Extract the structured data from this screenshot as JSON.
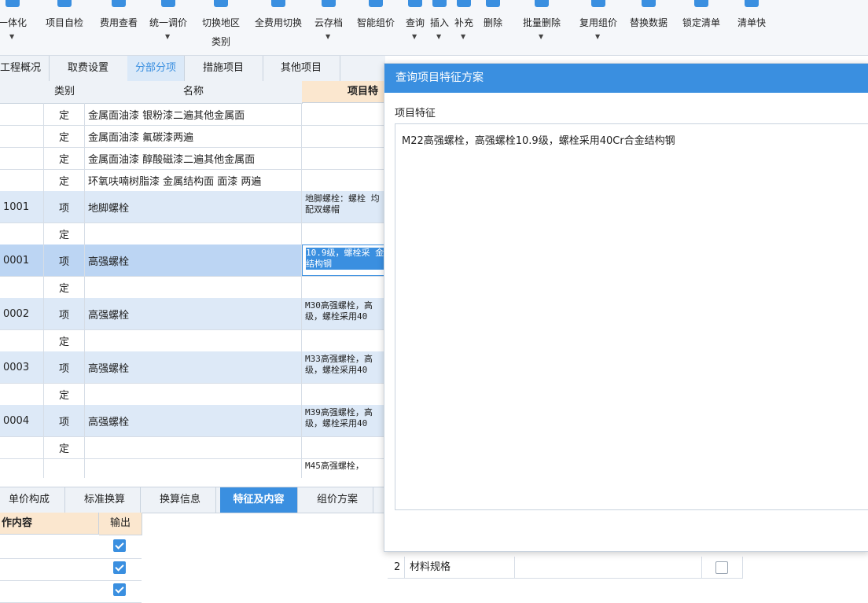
{
  "toolbar": {
    "buttons": [
      {
        "label": "一体化",
        "caret": true
      },
      {
        "label": "项目自检",
        "caret": false
      },
      {
        "label": "费用查看",
        "caret": false
      },
      {
        "label": "统一调价",
        "caret": true
      },
      {
        "label": "切换地区",
        "label2": "类别",
        "caret": false
      },
      {
        "label": "全费用切换",
        "caret": false
      },
      {
        "label": "云存档",
        "caret": true
      },
      {
        "label": "智能组价",
        "caret": false
      },
      {
        "label": "查询",
        "caret": true
      },
      {
        "label": "插入",
        "caret": true
      },
      {
        "label": "补充",
        "caret": true
      },
      {
        "label": "删除",
        "caret": false
      },
      {
        "label": "批量删除",
        "caret": true
      },
      {
        "label": "复用组价",
        "caret": true
      },
      {
        "label": "替换数据",
        "caret": false
      },
      {
        "label": "锁定清单",
        "caret": false
      },
      {
        "label": "清单快",
        "caret": false
      }
    ]
  },
  "tabs": [
    {
      "label": "工程概况"
    },
    {
      "label": "取费设置"
    },
    {
      "label": "分部分项"
    },
    {
      "label": "措施项目"
    },
    {
      "label": "其他项目"
    }
  ],
  "grid": {
    "headers": {
      "type": "类别",
      "name": "名称",
      "feature": "项目特"
    },
    "rows": [
      {
        "code": "",
        "type": "定",
        "name": "金属面油漆 银粉漆二遍其他金属面",
        "feature": ""
      },
      {
        "code": "",
        "type": "定",
        "name": "金属面油漆 氟碳漆两遍",
        "feature": ""
      },
      {
        "code": "",
        "type": "定",
        "name": "金属面油漆 醇酸磁漆二遍其他金属面",
        "feature": ""
      },
      {
        "code": "",
        "type": "定",
        "name": "环氧呋喃树脂漆 金属结构面 面漆 两遍",
        "feature": ""
      },
      {
        "code": "1001",
        "type": "项",
        "name": "地脚螺栓",
        "feature": "地脚螺栓：螺栓 均配双螺帽"
      },
      {
        "code": "",
        "type": "定",
        "name": "",
        "feature": ""
      },
      {
        "code": "0001",
        "type": "项",
        "name": "高强螺栓",
        "feature": "10.9级，螺栓采 金结构钢"
      },
      {
        "code": "",
        "type": "定",
        "name": "",
        "feature": ""
      },
      {
        "code": "0002",
        "type": "项",
        "name": "高强螺栓",
        "feature": "M30高强螺栓，高 级，螺栓采用40"
      },
      {
        "code": "",
        "type": "定",
        "name": "",
        "feature": ""
      },
      {
        "code": "0003",
        "type": "项",
        "name": "高强螺栓",
        "feature": "M33高强螺栓，高 级，螺栓采用40"
      },
      {
        "code": "",
        "type": "定",
        "name": "",
        "feature": ""
      },
      {
        "code": "0004",
        "type": "项",
        "name": "高强螺栓",
        "feature": "M39高强螺栓，高 级，螺栓采用40"
      },
      {
        "code": "",
        "type": "定",
        "name": "",
        "feature": ""
      },
      {
        "code": "",
        "type": "",
        "name": "",
        "feature": "M45高强螺栓，"
      }
    ]
  },
  "bottom_tabs": [
    {
      "label": "单价构成"
    },
    {
      "label": "标准换算"
    },
    {
      "label": "换算信息"
    },
    {
      "label": "特征及内容"
    },
    {
      "label": "组价方案"
    }
  ],
  "bottom_grid": {
    "headers": {
      "content": "作内容",
      "output": "输出"
    },
    "checks": [
      true,
      true,
      true
    ]
  },
  "dialog": {
    "title": "查询项目特征方案",
    "label": "项目特征",
    "content": "M22高强螺栓，高强螺栓10.9级，螺栓采用40Cr合金结构钢"
  },
  "under_table": {
    "row_index": "2",
    "row_label": "材料规格",
    "checked": false
  },
  "colors": {
    "accent": "#3a8fe0",
    "header_orange": "#fbe7cf",
    "item_row": "#dde9f7"
  }
}
